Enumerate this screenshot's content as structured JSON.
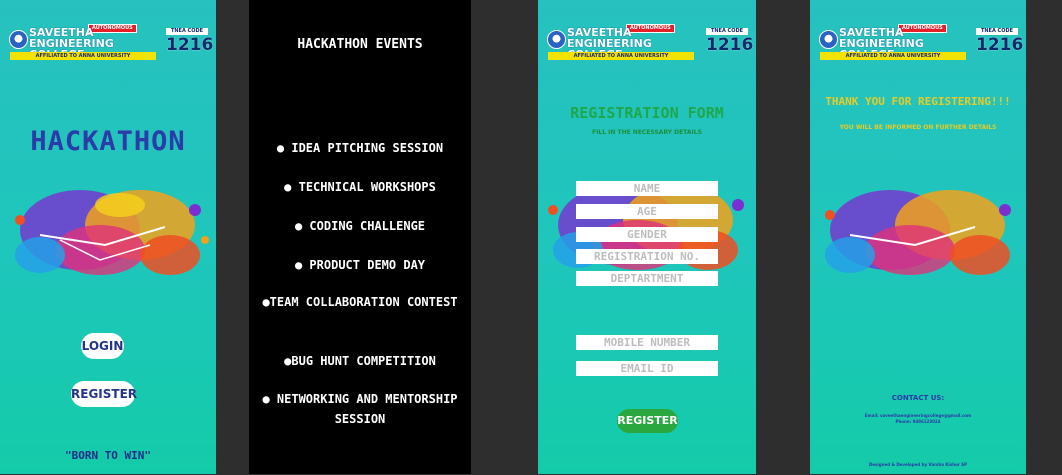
{
  "header": {
    "college_line1": "SAVEETHA",
    "college_line2": "ENGINEERING COLLEGE",
    "autonomous": "AUTONOMOUS",
    "affiliation": "AFFILIATED TO ANNA UNIVERSITY",
    "tnea_label": "TNEA CODE",
    "tnea_code": "1216"
  },
  "screen1": {
    "title": "HACKATHON",
    "login_label": "LOGIN",
    "register_label": "REGISTER",
    "motto": "\"BORN TO WIN\""
  },
  "screen2": {
    "title": "HACKATHON EVENTS",
    "events": [
      "● IDEA PITCHING SESSION",
      "● TECHNICAL WORKSHOPS",
      "● CODING CHALLENGE",
      "● PRODUCT DEMO DAY",
      "●TEAM COLLABORATION CONTEST",
      "●BUG HUNT COMPETITION",
      "● NETWORKING AND MENTORSHIP SESSION"
    ]
  },
  "screen3": {
    "title": "REGISTRATION FORM",
    "subtitle": "FILL IN THE NECESSARY DETAILS",
    "fields": {
      "name": "NAME",
      "age": "AGE",
      "gender": "GENDER",
      "registration_no": "REGISTRATION NO.",
      "department": "DEPTARTMENT",
      "mobile": "MOBILE NUMBER",
      "email": "EMAIL ID"
    },
    "register_label": "REGISTER"
  },
  "screen4": {
    "thanks": "THANK YOU FOR REGISTERING!!!",
    "inform": "YOU WILL BE INFORMED ON FURTHER DETAILS",
    "contact_title": "CONTACT US:",
    "email_line": "Email: saveethaengineeringcollege@gmail.com",
    "phone_line": "Phone: 9486123024",
    "credit": "Designed & Developed by Varsha Kishor SP"
  },
  "colors": {
    "teal": "#1ec6bb",
    "title_blue": "#2b3ba8",
    "form_green": "#1ea84a",
    "thanks_yellow": "#e6cc23"
  }
}
